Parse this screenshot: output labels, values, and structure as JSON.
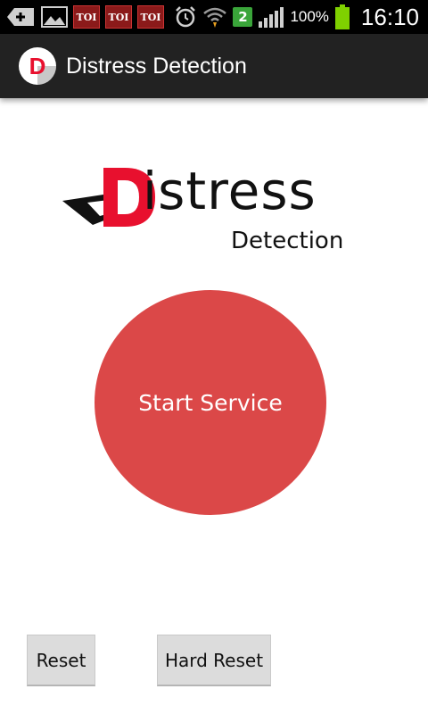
{
  "status_bar": {
    "notifications": [
      "TOI",
      "TOI",
      "TOI"
    ],
    "data_badge": "2",
    "battery_pct": "100%",
    "time": "16:10",
    "icons": [
      "add-icon",
      "image-icon",
      "alarm-icon",
      "wifi-icon",
      "signal-icon",
      "battery-icon"
    ]
  },
  "action_bar": {
    "app_icon_letter": "D",
    "title": "Distress Detection"
  },
  "logo": {
    "initial": "D",
    "main": "istress",
    "sub": "Detection"
  },
  "main": {
    "start_label": "Start Service"
  },
  "buttons": {
    "reset_label": "Reset",
    "hard_reset_label": "Hard Reset"
  },
  "colors": {
    "accent_red": "#db4848",
    "logo_red": "#e8102e",
    "action_bar_bg": "#222222",
    "status_bar_bg": "#000000"
  }
}
